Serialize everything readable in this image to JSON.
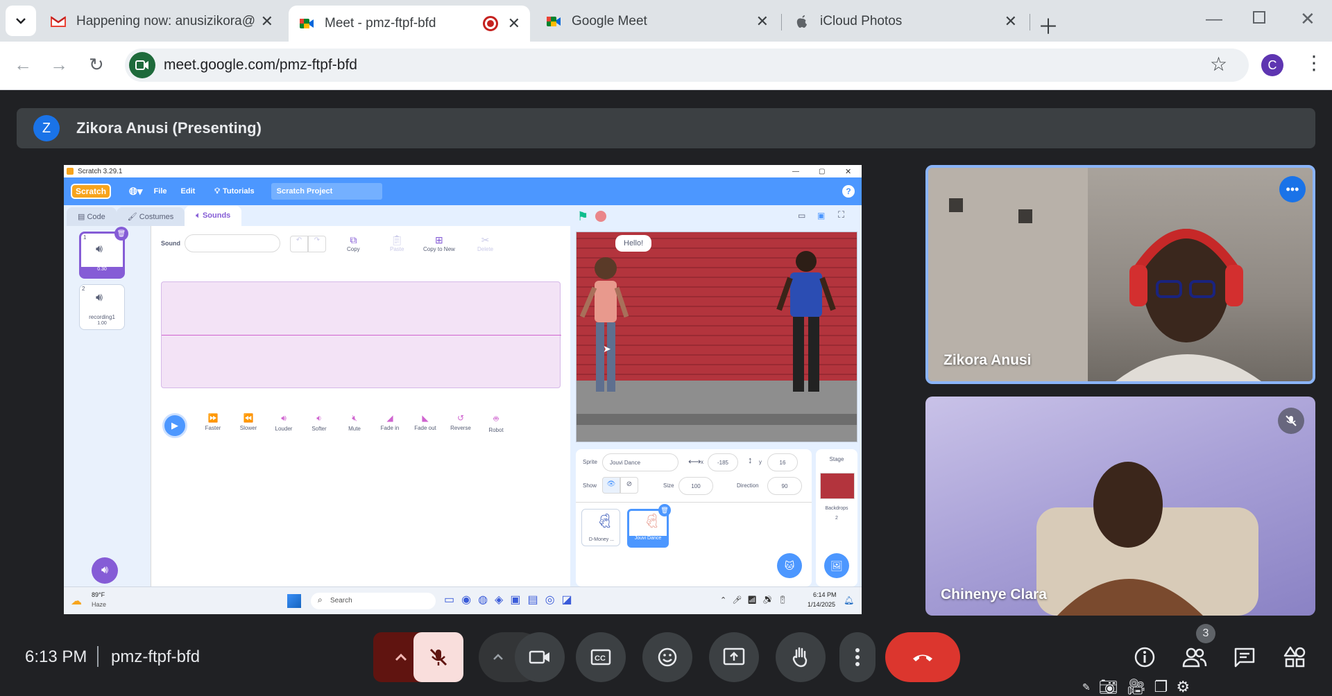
{
  "browser": {
    "tabs": [
      {
        "title": "Happening now: anusizikora@g",
        "icon": "gmail-icon"
      },
      {
        "title": "Meet - pmz-ftpf-bfd",
        "icon": "meet-icon",
        "recording": true
      },
      {
        "title": "Google Meet",
        "icon": "meet-icon"
      },
      {
        "title": "iCloud Photos",
        "icon": "apple-icon"
      }
    ],
    "url": "meet.google.com/pmz-ftpf-bfd",
    "profile_initial": "C"
  },
  "meet": {
    "presenter_initial": "Z",
    "presenter_label": "Zikora Anusi (Presenting)",
    "time": "6:13 PM",
    "meeting_code": "pmz-ftpf-bfd",
    "participant_count": "3",
    "participants": [
      {
        "name": "Zikora Anusi"
      },
      {
        "name": "Chinenye Clara"
      }
    ]
  },
  "scratch": {
    "window_title": "Scratch 3.29.1",
    "logo": "Scratch",
    "menu": {
      "file": "File",
      "edit": "Edit",
      "tutorials": "Tutorials"
    },
    "project_title": "Scratch Project",
    "tabs": {
      "code": "Code",
      "costumes": "Costumes",
      "sounds": "Sounds"
    },
    "sounds": [
      {
        "index": "1",
        "name": "",
        "duration": "0.30"
      },
      {
        "index": "2",
        "name": "recording1",
        "duration": "1.00"
      }
    ],
    "sound_label": "Sound",
    "edit_tools": {
      "copy": "Copy",
      "paste": "Paste",
      "copy_to_new": "Copy to New",
      "delete": "Delete"
    },
    "effects": [
      "Faster",
      "Slower",
      "Louder",
      "Softer",
      "Mute",
      "Fade in",
      "Fade out",
      "Reverse",
      "Robot"
    ],
    "speech": "Hello!",
    "sprite_info": {
      "sprite_label": "Sprite",
      "sprite_name": "Jouvi Dance",
      "x_label": "x",
      "x": "-185",
      "y_label": "y",
      "y": "16",
      "show_label": "Show",
      "size_label": "Size",
      "size": "100",
      "direction_label": "Direction",
      "direction": "90"
    },
    "sprites": [
      {
        "name": "D-Money ..."
      },
      {
        "name": "Jouvi Dance"
      }
    ],
    "stage_panel": {
      "label": "Stage",
      "backdrops_label": "Backdrops",
      "backdrops": "2"
    },
    "taskbar": {
      "temp": "89°F",
      "weather": "Haze",
      "search": "Search",
      "time": "6:14 PM",
      "date": "1/14/2025"
    }
  }
}
